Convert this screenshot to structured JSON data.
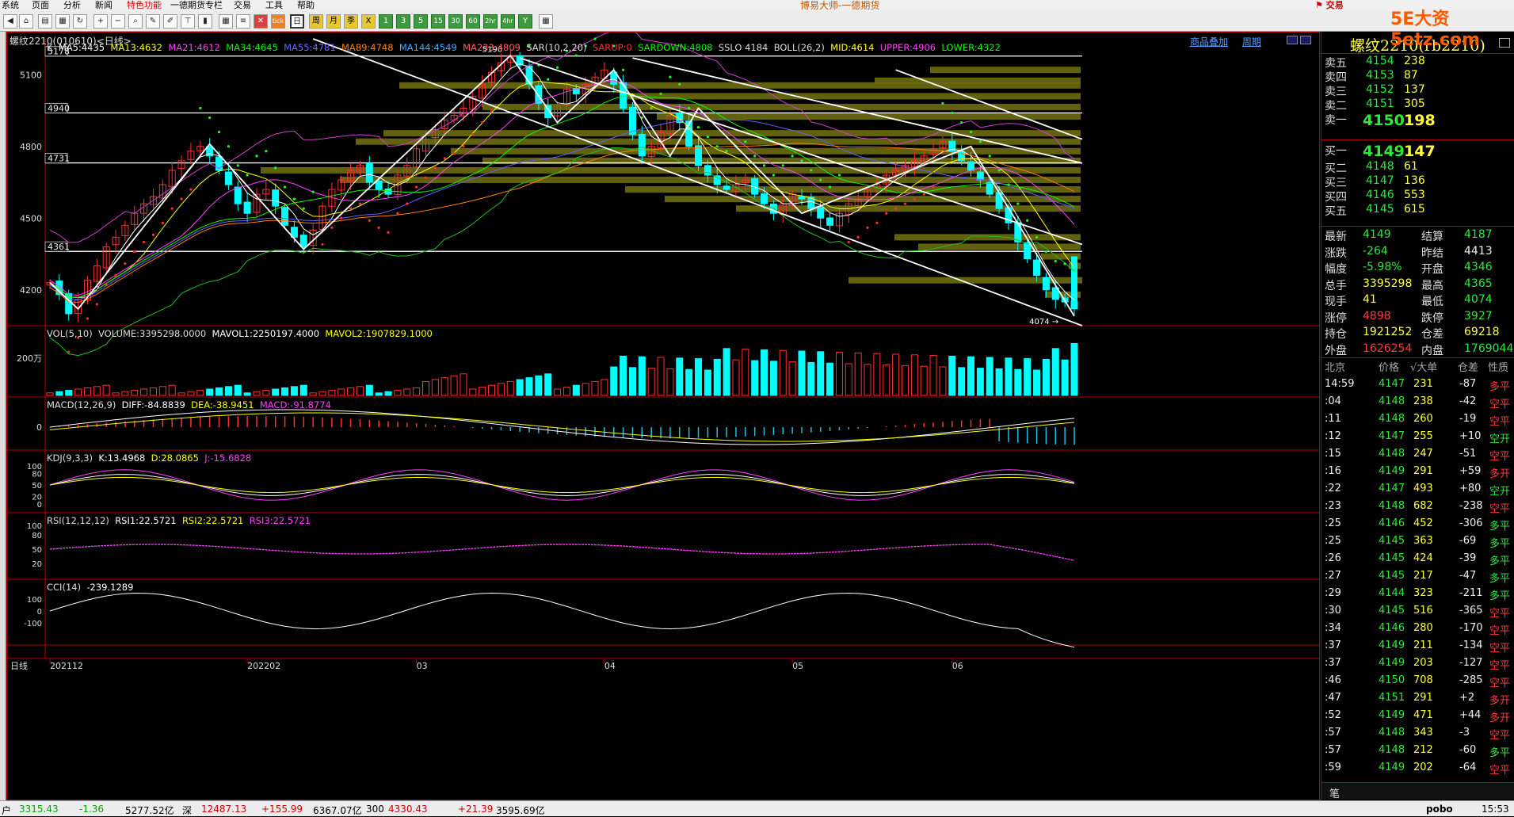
{
  "menu": {
    "items": [
      "系统",
      "页面",
      "分析",
      "新闻",
      "特色功能",
      "一德期货专栏",
      "交易",
      "工具",
      "帮助"
    ],
    "title": "博易大师-一德期货",
    "trade_button": "交易",
    "watermark": "5E大资5etz.com"
  },
  "toolbar": {
    "buttons": [
      "back",
      "home",
      "folder",
      "refresh",
      "zoom-in",
      "zoom-out",
      "draw",
      "stats",
      "table",
      "indicator",
      "tick",
      "daily",
      "weekly",
      "monthly",
      "quarterly",
      "1m",
      "3m",
      "5m",
      "15m",
      "30m",
      "60m",
      "2h",
      "4h",
      "yearly",
      "calculator"
    ],
    "labels": {
      "tick": "tick",
      "daily": "日",
      "weekly": "周",
      "monthly": "月",
      "quarterly": "季",
      "1m": "1",
      "3m": "3",
      "5m": "5",
      "15m": "15",
      "30m": "30",
      "60m": "60",
      "2h": "2hr",
      "4h": "4hr",
      "yearly": "Y"
    }
  },
  "chart": {
    "title": "螺纹2210(010610)<日线>",
    "links": [
      "商品叠加",
      "周期"
    ],
    "main_indicators": {
      "k": "K",
      "ma5": "MA5:4435",
      "ma13": "MA13:4632",
      "ma21": "MA21:4612",
      "ma34": "MA34:4645",
      "ma55": "MA55:4781",
      "ma89": "MA89:4748",
      "ma144": "MA144:4549",
      "ma233": "MA233:4809",
      "sar": "SAR(10,2,20)",
      "sarup": "SARUP:0",
      "sardown": "SARDOWN:4808",
      "sslo": "SSLO 4184",
      "boll": "BOLL(26,2)",
      "mid": "MID:4614",
      "upper": "UPPER:4906",
      "lower": "LOWER:4322"
    },
    "price_axis": [
      "5100",
      "4800",
      "4500",
      "4200"
    ],
    "level_boxes": [
      "5178",
      "4940",
      "4731",
      "4361"
    ],
    "high_label": "5190",
    "low_label": "4074",
    "vol": {
      "name": "VOL(5,10)",
      "volume": "VOLUME:3395298.0000",
      "mavol1": "MAVOL1:2250197.4000",
      "mavol2": "MAVOL2:1907829.1000",
      "axis": "200万"
    },
    "macd": {
      "name": "MACD(12,26,9)",
      "diff": "DIFF:-84.8839",
      "dea": "DEA:-38.9451",
      "macd": "MACD:-91.8774",
      "axis": "0"
    },
    "kdj": {
      "name": "KDJ(9,3,3)",
      "k": "K:13.4968",
      "d": "D:28.0865",
      "j": "J:-15.6828",
      "axis": [
        "100",
        "80",
        "50",
        "20",
        "0"
      ]
    },
    "rsi": {
      "name": "RSI(12,12,12)",
      "rsi1": "RSI1:22.5721",
      "rsi2": "RSI2:22.5721",
      "rsi3": "RSI3:22.5721",
      "axis": [
        "100",
        "80",
        "50",
        "20"
      ]
    },
    "cci": {
      "name": "CCI(14)",
      "value": "-239.1289",
      "axis": [
        "100",
        "0",
        "-100"
      ]
    },
    "date_axis": {
      "label": "日线",
      "dates": [
        "202112",
        "202202",
        "03",
        "04",
        "05",
        "06"
      ]
    },
    "colors": {
      "up": "#ff3030",
      "down": "#00ffff",
      "ma5": "#ffffff",
      "ma13": "#ffff00",
      "ma21": "#ff40ff",
      "ma34": "#00ff00",
      "ma55": "#6060ff",
      "ma89": "#ff8000"
    }
  },
  "quote": {
    "title": "螺纹2210(rb2210)",
    "asks": [
      {
        "label": "卖五",
        "price": "4154",
        "vol": "238"
      },
      {
        "label": "卖四",
        "price": "4153",
        "vol": "87"
      },
      {
        "label": "卖三",
        "price": "4152",
        "vol": "137"
      },
      {
        "label": "卖二",
        "price": "4151",
        "vol": "305"
      },
      {
        "label": "卖一",
        "price": "4150",
        "vol": "198"
      }
    ],
    "bids": [
      {
        "label": "买一",
        "price": "4149",
        "vol": "147"
      },
      {
        "label": "买二",
        "price": "4148",
        "vol": "61"
      },
      {
        "label": "买三",
        "price": "4147",
        "vol": "136"
      },
      {
        "label": "买四",
        "price": "4146",
        "vol": "553"
      },
      {
        "label": "买五",
        "price": "4145",
        "vol": "615"
      }
    ],
    "stats": [
      {
        "l1": "最新",
        "v1": "4149",
        "c1": "grn",
        "l2": "结算",
        "v2": "4187",
        "c2": "grn"
      },
      {
        "l1": "涨跌",
        "v1": "-264",
        "c1": "grn",
        "l2": "昨结",
        "v2": "4413",
        "c2": "wht"
      },
      {
        "l1": "幅度",
        "v1": "-5.98%",
        "c1": "grn",
        "l2": "开盘",
        "v2": "4346",
        "c2": "grn"
      },
      {
        "l1": "总手",
        "v1": "3395298",
        "c1": "yel",
        "l2": "最高",
        "v2": "4365",
        "c2": "grn"
      },
      {
        "l1": "现手",
        "v1": "41",
        "c1": "yel",
        "l2": "最低",
        "v2": "4074",
        "c2": "grn"
      },
      {
        "l1": "涨停",
        "v1": "4898",
        "c1": "red",
        "l2": "跌停",
        "v2": "3927",
        "c2": "grn"
      },
      {
        "l1": "持仓",
        "v1": "1921252",
        "c1": "yel",
        "l2": "仓差",
        "v2": "69218",
        "c2": "yel"
      },
      {
        "l1": "外盘",
        "v1": "1626254",
        "c1": "red",
        "l2": "内盘",
        "v2": "1769044",
        "c2": "grn"
      }
    ],
    "tick_header": {
      "time": "北京",
      "price": "价格",
      "vol": "√大单",
      "oi": "仓差",
      "nature": "性质"
    },
    "ticks": [
      {
        "time": "14:59",
        "price": "4147",
        "vol": "231",
        "oi": "-87",
        "nature": "多平",
        "c": "red"
      },
      {
        "time": ":04",
        "price": "4148",
        "vol": "238",
        "oi": "-42",
        "nature": "空平",
        "c": "red"
      },
      {
        "time": ":11",
        "price": "4148",
        "vol": "260",
        "oi": "-19",
        "nature": "空平",
        "c": "red"
      },
      {
        "time": ":12",
        "price": "4147",
        "vol": "255",
        "oi": "+10",
        "nature": "空开",
        "c": "grn"
      },
      {
        "time": ":15",
        "price": "4148",
        "vol": "247",
        "oi": "-51",
        "nature": "空平",
        "c": "red"
      },
      {
        "time": ":16",
        "price": "4149",
        "vol": "291",
        "oi": "+59",
        "nature": "多开",
        "c": "red"
      },
      {
        "time": ":22",
        "price": "4147",
        "vol": "493",
        "oi": "+80",
        "nature": "空开",
        "c": "grn"
      },
      {
        "time": ":23",
        "price": "4148",
        "vol": "682",
        "oi": "-238",
        "nature": "空平",
        "c": "red"
      },
      {
        "time": ":25",
        "price": "4146",
        "vol": "452",
        "oi": "-306",
        "nature": "多平",
        "c": "grn"
      },
      {
        "time": ":25",
        "price": "4145",
        "vol": "363",
        "oi": "-69",
        "nature": "多平",
        "c": "grn"
      },
      {
        "time": ":26",
        "price": "4145",
        "vol": "424",
        "oi": "-39",
        "nature": "多平",
        "c": "grn"
      },
      {
        "time": ":27",
        "price": "4145",
        "vol": "217",
        "oi": "-47",
        "nature": "多平",
        "c": "grn"
      },
      {
        "time": ":29",
        "price": "4144",
        "vol": "323",
        "oi": "-211",
        "nature": "多平",
        "c": "grn"
      },
      {
        "time": ":30",
        "price": "4145",
        "vol": "516",
        "oi": "-365",
        "nature": "空平",
        "c": "red"
      },
      {
        "time": ":34",
        "price": "4146",
        "vol": "280",
        "oi": "-170",
        "nature": "空平",
        "c": "red"
      },
      {
        "time": ":37",
        "price": "4149",
        "vol": "211",
        "oi": "-134",
        "nature": "空平",
        "c": "red"
      },
      {
        "time": ":37",
        "price": "4149",
        "vol": "203",
        "oi": "-127",
        "nature": "空平",
        "c": "red"
      },
      {
        "time": ":46",
        "price": "4150",
        "vol": "708",
        "oi": "-285",
        "nature": "空平",
        "c": "red"
      },
      {
        "time": ":47",
        "price": "4151",
        "vol": "291",
        "oi": "+2",
        "nature": "多开",
        "c": "red"
      },
      {
        "time": ":52",
        "price": "4149",
        "vol": "471",
        "oi": "+44",
        "nature": "多开",
        "c": "red"
      },
      {
        "time": ":57",
        "price": "4148",
        "vol": "343",
        "oi": "-3",
        "nature": "空平",
        "c": "red"
      },
      {
        "time": ":57",
        "price": "4148",
        "vol": "212",
        "oi": "-60",
        "nature": "多平",
        "c": "grn"
      },
      {
        "time": ":59",
        "price": "4149",
        "vol": "202",
        "oi": "-64",
        "nature": "空平",
        "c": "red"
      }
    ],
    "bottom_tab": "笔"
  },
  "statusbar": {
    "items": [
      {
        "text": "户",
        "c": "#000"
      },
      {
        "text": "3315.43",
        "c": "#0a0"
      },
      {
        "text": "-1.36",
        "c": "#0a0"
      },
      {
        "text": "5277.52亿",
        "c": "#000"
      },
      {
        "text": "深",
        "c": "#000"
      },
      {
        "text": "12487.13",
        "c": "#c00"
      },
      {
        "text": "+155.99",
        "c": "#c00"
      },
      {
        "text": "6367.07亿",
        "c": "#000"
      },
      {
        "text": "300",
        "c": "#000"
      },
      {
        "text": "4330.43",
        "c": "#c00"
      },
      {
        "text": "+21.39",
        "c": "#c00"
      },
      {
        "text": "3595.69亿",
        "c": "#000"
      }
    ],
    "brand": "pobo",
    "time": "15:53"
  }
}
